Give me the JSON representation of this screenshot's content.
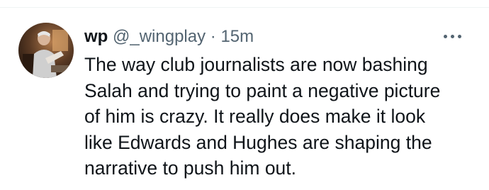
{
  "tweet": {
    "display_name": "wp",
    "handle": "@_wingplay",
    "separator": "·",
    "timestamp": "15m",
    "avatar_icon": "user-avatar-photo",
    "more_icon": "more-options-icon",
    "text_lines": [
      "The way club journalists are now bashing",
      "Salah and trying to paint a negative picture",
      "of him is crazy. It really does make it look",
      "like Edwards and Hughes are shaping the",
      "narrative to push him out."
    ]
  },
  "colors": {
    "text_primary": "#0f1419",
    "text_secondary": "#536471",
    "divider": "#eff3f4"
  }
}
